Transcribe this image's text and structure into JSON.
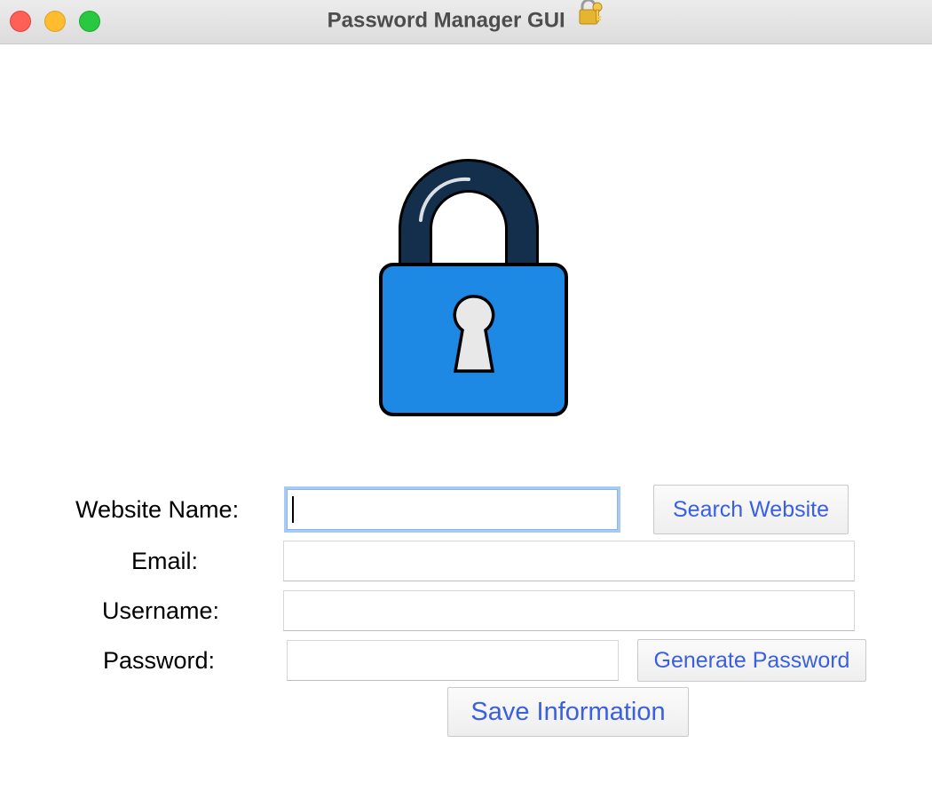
{
  "window": {
    "title": "Password Manager GUI",
    "title_icon": "locked-with-key-icon"
  },
  "logo": {
    "icon": "padlock-icon",
    "colors": {
      "shackle": "#132f4c",
      "body": "#1e88e5",
      "keyhole": "#e8e8e8",
      "outline": "#000000"
    }
  },
  "form": {
    "website_label": "Website Name:",
    "website_value": "",
    "search_button": "Search Website",
    "email_label": "Email:",
    "email_value": "",
    "username_label": "Username:",
    "username_value": "",
    "password_label": "Password:",
    "password_value": "",
    "generate_button": "Generate Password",
    "save_button": "Save Information"
  },
  "colors": {
    "button_text": "#3a5fe0",
    "focus_ring": "#a7cbf4"
  }
}
